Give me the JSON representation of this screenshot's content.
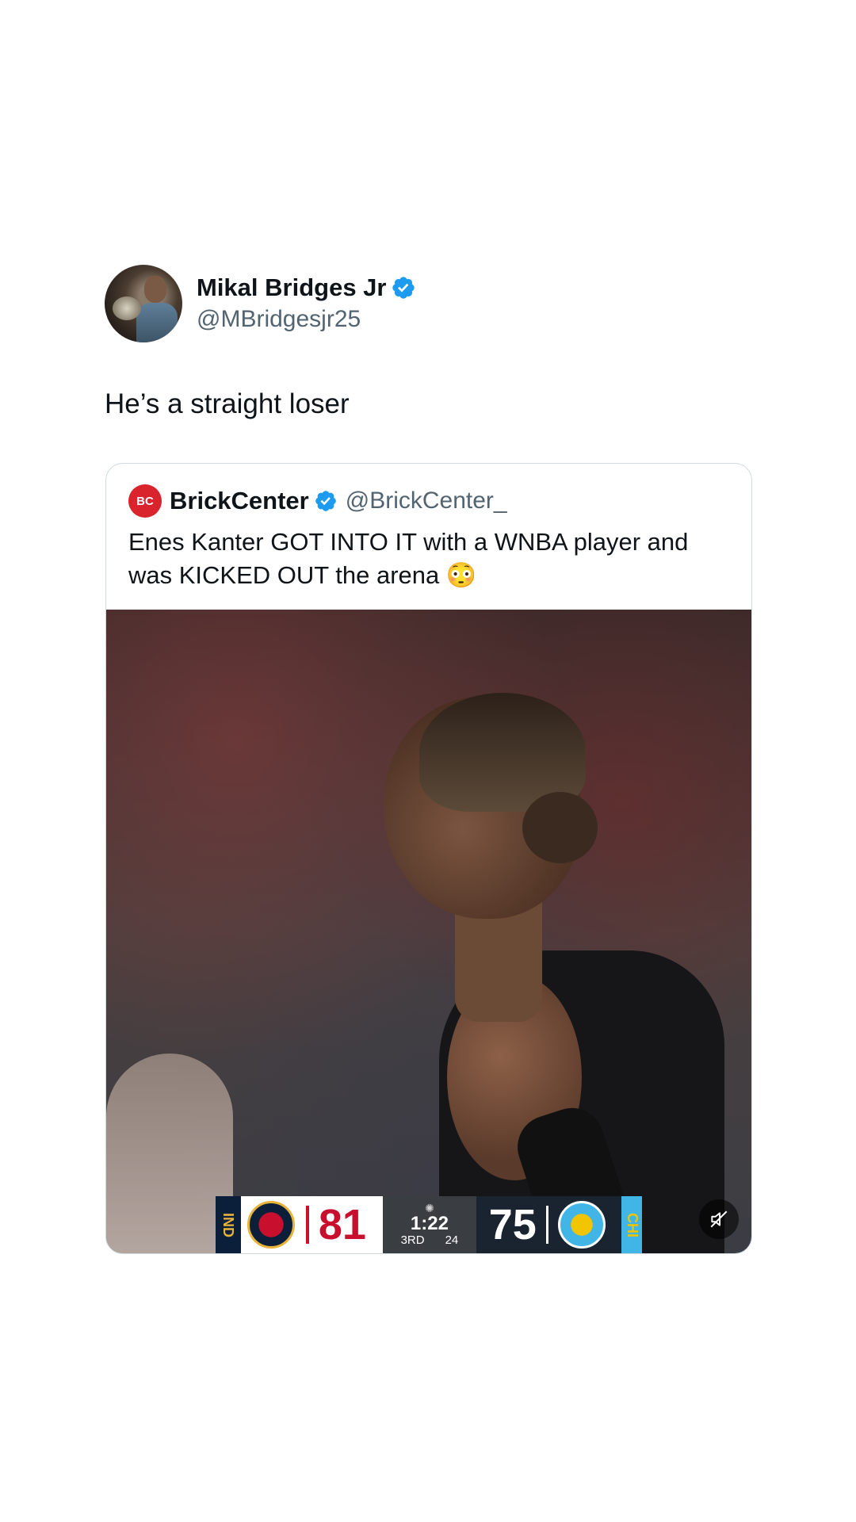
{
  "tweet": {
    "display_name": "Mikal Bridges Jr",
    "handle": "@MBridgesjr25",
    "text": "He’s a straight loser",
    "verified_icon": "verified-badge-icon"
  },
  "quoted_tweet": {
    "logo_text": "BC",
    "display_name": "BrickCenter",
    "handle": "@BrickCenter_",
    "text": "Enes Kanter GOT INTO IT with a WNBA player and was KICKED OUT the arena 😳"
  },
  "scorebug": {
    "home_tag": "IND",
    "home_score": "81",
    "clock": "1:22",
    "period": "3RD",
    "shot_clock": "24",
    "away_score": "75",
    "away_tag": "CHI"
  },
  "colors": {
    "accent": "#1d9bf0",
    "text": "#0f1419",
    "secondary": "#536471",
    "brickcenter_red": "#d9232d"
  }
}
